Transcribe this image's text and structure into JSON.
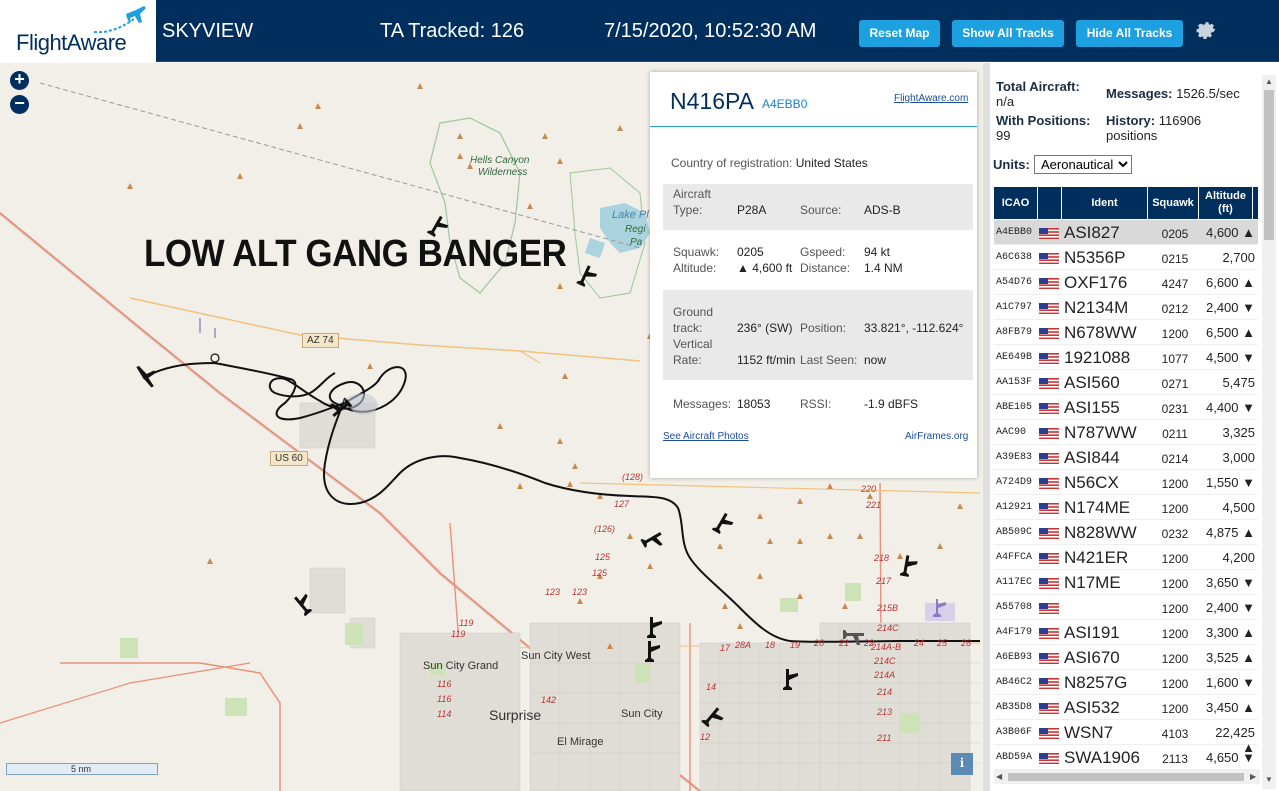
{
  "header": {
    "brand": "FlightAware",
    "app_name": "SKYVIEW",
    "tracked": "TA Tracked: 126",
    "datetime": "7/15/2020, 10:52:30 AM",
    "reset_label": "Reset Map",
    "show_label": "Show All Tracks",
    "hide_label": "Hide All Tracks",
    "settings_icon": "gear-icon",
    "accent_color": "#1ca0e0",
    "bar_color": "#002f5d"
  },
  "map": {
    "annotation": "LOW ALT GANG BANGER",
    "zoom_in": "+",
    "zoom_out": "−",
    "scale_label": "5 nm",
    "info": "i",
    "labels": {
      "hells_canyon": "Hells Canyon",
      "wilderness": "Wilderness",
      "lake": "Lake Pl",
      "regi": "Regi",
      "pa": "Pa",
      "az74": "AZ 74",
      "us60": "US 60",
      "sun_city_grand": "Sun City Grand",
      "sun_city_west": "Sun City West",
      "surprise": "Surprise",
      "sun_city": "Sun City",
      "el_mirage": "El Mirage"
    },
    "routes": [
      "(128)",
      "127",
      "(126)",
      "125",
      "125",
      "123",
      "123",
      "119",
      "119",
      "116",
      "116",
      "114",
      "142",
      "28A",
      "17",
      "18",
      "19",
      "20",
      "21",
      "22",
      "24",
      "25",
      "26",
      "220",
      "221",
      "218",
      "217",
      "215B",
      "214C",
      "214A-B",
      "214C",
      "214A",
      "214",
      "213",
      "211",
      "14",
      "12"
    ]
  },
  "selected": {
    "registration": "N416PA",
    "icao": "A4EBB0",
    "fa_link": "FlightAware.com",
    "country_label": "Country of registration:",
    "country": "United States",
    "type_label_1": "Aircraft",
    "type_label_2": "Type:",
    "type": "P28A",
    "source_label": "Source:",
    "source": "ADS-B",
    "squawk_label": "Squawk:",
    "squawk": "0205",
    "gspeed_label": "Gspeed:",
    "gspeed": "94 kt",
    "altitude_label": "Altitude:",
    "altitude": "▲ 4,600 ft",
    "distance_label": "Distance:",
    "distance": "1.4 NM",
    "track_label_1": "Ground",
    "track_label_2": "track:",
    "track": "236° (SW)",
    "position_label": "Position:",
    "position": "33.821°, -112.624°",
    "vrate_label_1": "Vertical",
    "vrate_label_2": "Rate:",
    "vrate": "1152 ft/min",
    "lastseen_label": "Last Seen:",
    "lastseen": "now",
    "messages_label": "Messages:",
    "messages": "18053",
    "rssi_label": "RSSI:",
    "rssi": "-1.9 dBFS",
    "photos_link": "See Aircraft Photos",
    "airframes_link": "AirFrames.org"
  },
  "sidebar": {
    "total_label": "Total Aircraft:",
    "total_value": "n/a",
    "messages_label": "Messages:",
    "messages_value": "1526.5/sec",
    "withpos_label": "With Positions:",
    "withpos_value": "99",
    "history_label": "History:",
    "history_value_1": "116906",
    "history_value_2": "positions",
    "units_label": "Units:",
    "units_value": "Aeronautical"
  },
  "table": {
    "columns": [
      "ICAO",
      "Ident",
      "Squawk",
      "Altitude (ft)"
    ],
    "rows": [
      {
        "icao": "A4EBB0",
        "ident": "ASI827",
        "squawk": "0205",
        "alt": "4,600 ▲"
      },
      {
        "icao": "A6C638",
        "ident": "N5356P",
        "squawk": "0215",
        "alt": "2,700"
      },
      {
        "icao": "A54D76",
        "ident": "OXF176",
        "squawk": "4247",
        "alt": "6,600 ▲"
      },
      {
        "icao": "A1C797",
        "ident": "N2134M",
        "squawk": "0212",
        "alt": "2,400 ▼"
      },
      {
        "icao": "A8FB79",
        "ident": "N678WW",
        "squawk": "1200",
        "alt": "6,500 ▲"
      },
      {
        "icao": "AE649B",
        "ident": "1921088",
        "squawk": "1077",
        "alt": "4,500 ▼"
      },
      {
        "icao": "AA153F",
        "ident": "ASI560",
        "squawk": "0271",
        "alt": "5,475"
      },
      {
        "icao": "ABE105",
        "ident": "ASI155",
        "squawk": "0231",
        "alt": "4,400 ▼"
      },
      {
        "icao": "AAC90",
        "ident": "N787WW",
        "squawk": "0211",
        "alt": "3,325"
      },
      {
        "icao": "A39E83",
        "ident": "ASI844",
        "squawk": "0214",
        "alt": "3,000"
      },
      {
        "icao": "A724D9",
        "ident": "N56CX",
        "squawk": "1200",
        "alt": "1,550 ▼"
      },
      {
        "icao": "A12921",
        "ident": "N174ME",
        "squawk": "1200",
        "alt": "4,500"
      },
      {
        "icao": "AB509C",
        "ident": "N828WW",
        "squawk": "0232",
        "alt": "4,875 ▲"
      },
      {
        "icao": "A4FFCA",
        "ident": "N421ER",
        "squawk": "1200",
        "alt": "4,200"
      },
      {
        "icao": "A117EC",
        "ident": "N17ME",
        "squawk": "1200",
        "alt": "3,650 ▼"
      },
      {
        "icao": "A55708",
        "ident": "",
        "squawk": "1200",
        "alt": "2,400 ▼"
      },
      {
        "icao": "A4F179",
        "ident": "ASI191",
        "squawk": "1200",
        "alt": "3,300 ▲"
      },
      {
        "icao": "A6EB93",
        "ident": "ASI670",
        "squawk": "1200",
        "alt": "3,525 ▲"
      },
      {
        "icao": "AB46C2",
        "ident": "N8257G",
        "squawk": "1200",
        "alt": "1,600 ▼"
      },
      {
        "icao": "AB35D8",
        "ident": "ASI532",
        "squawk": "1200",
        "alt": "3,450 ▲"
      },
      {
        "icao": "A3B06F",
        "ident": "WSN7",
        "squawk": "4103",
        "alt": "22,425 ▲"
      },
      {
        "icao": "ABD59A",
        "ident": "SWA1906",
        "squawk": "2113",
        "alt": "4,650 ▼"
      }
    ]
  }
}
